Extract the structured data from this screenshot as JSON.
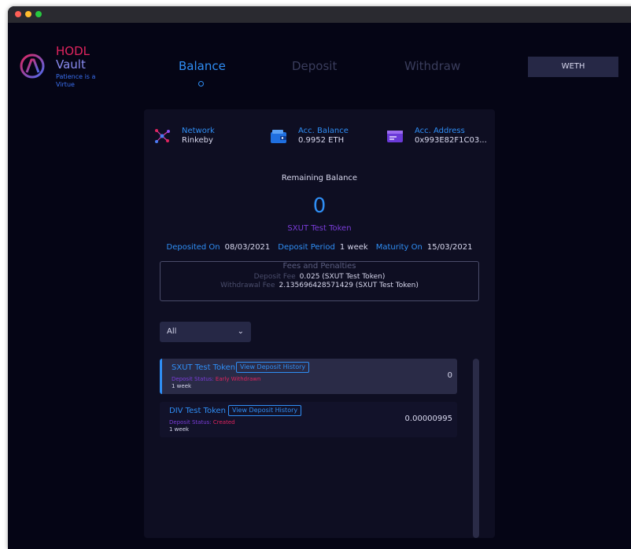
{
  "brand": {
    "name_line1": "HODL",
    "name_line2": "Vault",
    "tagline": "Patience is a Virtue",
    "logo_icon": "hodl-logo-icon"
  },
  "nav": {
    "tabs": [
      {
        "label": "Balance",
        "active": true
      },
      {
        "label": "Deposit",
        "active": false
      },
      {
        "label": "Withdraw",
        "active": false
      }
    ],
    "token_button": "WETH"
  },
  "account": {
    "network_label": "Network",
    "network_value": "Rinkeby",
    "balance_label": "Acc. Balance",
    "balance_value": "0.9952 ETH",
    "address_label": "Acc. Address",
    "address_value": "0x993E82F1C03..."
  },
  "balance": {
    "remaining_label": "Remaining Balance",
    "remaining_value": "0",
    "token_name": "SXUT Test Token",
    "deposited_on_label": "Deposited On",
    "deposited_on_value": "08/03/2021",
    "deposit_period_label": "Deposit Period",
    "deposit_period_value": "1 week",
    "maturity_on_label": "Maturity On",
    "maturity_on_value": "15/03/2021"
  },
  "fees": {
    "title": "Fees and Penalties",
    "deposit_fee_label": "Deposit Fee",
    "deposit_fee_value": "0.025 (SXUT Test Token)",
    "withdrawal_fee_label": "Withdrawal Fee",
    "withdrawal_fee_value": "2.135696428571429 (SXUT Test Token)"
  },
  "filter": {
    "selected": "All"
  },
  "deposits": [
    {
      "name": "SXUT Test Token",
      "history_label": "View Deposit History",
      "status_label": "Deposit Status:",
      "status_value": "Early Withdrawn",
      "period": "1 week",
      "amount": "0",
      "active": true
    },
    {
      "name": "DIV Test Token",
      "history_label": "View Deposit History",
      "status_label": "Deposit Status:",
      "status_value": "Created",
      "period": "1 week",
      "amount": "0.00000995",
      "active": false
    }
  ],
  "colors": {
    "accent": "#2f8ef5",
    "brand": "#e0245e",
    "purple": "#7a3cd8",
    "background": "#050515",
    "card": "#0e0e22"
  }
}
